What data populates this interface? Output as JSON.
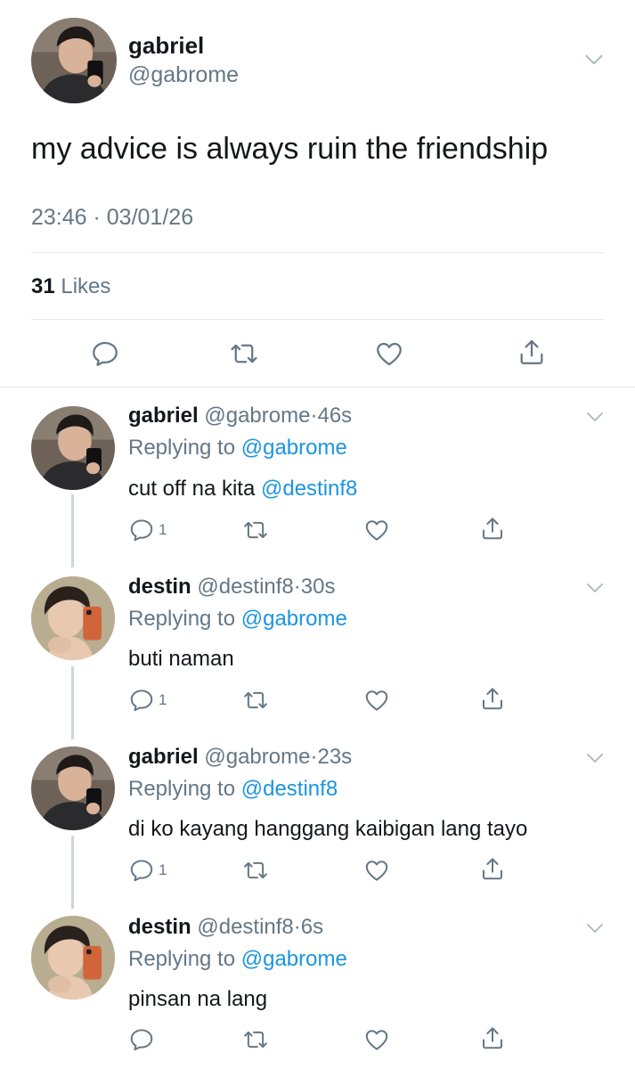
{
  "main_tweet": {
    "name": "gabriel",
    "handle": "@gabrome",
    "text": "my advice is always ruin the friendship",
    "timestamp": "23:46 · 03/01/26",
    "likes_count": "31",
    "likes_label": "Likes"
  },
  "replies": [
    {
      "name": "gabriel",
      "handle": "@gabrome",
      "sep": "·",
      "time": "46s",
      "replying_label": "Replying to",
      "replying_to": "@gabrome",
      "text": "cut off na kita ",
      "mention": "@destinf8",
      "reply_count": "1"
    },
    {
      "name": "destin",
      "handle": "@destinf8",
      "sep": "·",
      "time": "30s",
      "replying_label": "Replying to",
      "replying_to": "@gabrome",
      "text": "buti naman",
      "reply_count": "1"
    },
    {
      "name": "gabriel",
      "handle": "@gabrome",
      "sep": "·",
      "time": "23s",
      "replying_label": "Replying to",
      "replying_to": "@destinf8",
      "text": "di ko kayang hanggang kaibigan lang tayo",
      "reply_count": "1"
    },
    {
      "name": "destin",
      "handle": "@destinf8",
      "sep": "·",
      "time": "6s",
      "replying_label": "Replying to",
      "replying_to": "@gabrome",
      "text": "pinsan na lang",
      "reply_count": ""
    }
  ],
  "icons": {
    "reply": "reply-icon",
    "retweet": "retweet-icon",
    "like": "heart-icon",
    "share": "share-icon",
    "menu": "chevron-down-icon"
  },
  "colors": {
    "text": "#14171a",
    "secondary": "#657786",
    "link": "#1b95e0",
    "divider": "#e1e8ed",
    "thread_line": "#ccd6dd"
  }
}
